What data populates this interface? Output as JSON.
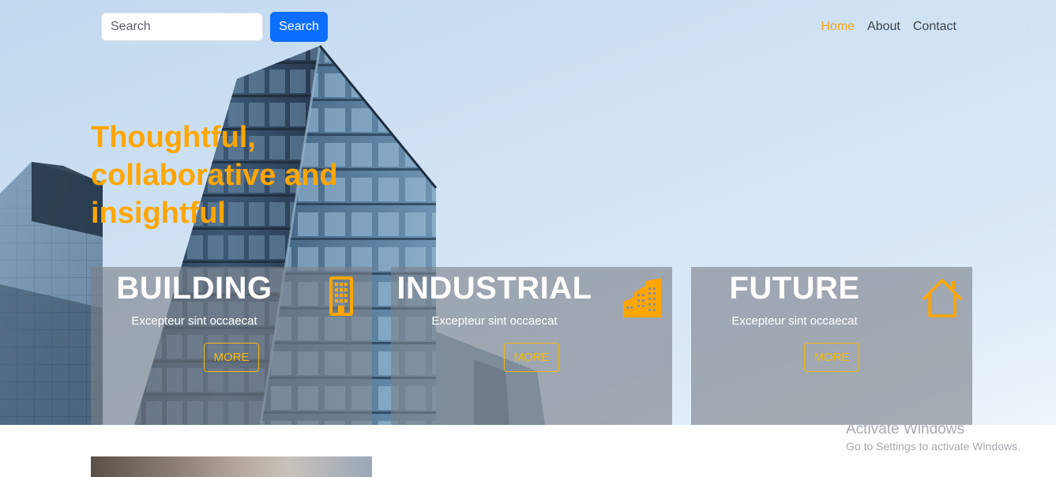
{
  "navbar": {
    "search": {
      "placeholder": "Search",
      "value": ""
    },
    "search_button_label": "Search",
    "links": [
      {
        "label": "Home",
        "active": true
      },
      {
        "label": "About",
        "active": false
      },
      {
        "label": "Contact",
        "active": false
      }
    ]
  },
  "hero": {
    "headline": "Thoughtful, collaborative and insightful"
  },
  "cards": [
    {
      "title": "BUILDING",
      "subtitle": "Excepteur sint occaecat",
      "button_label": "MORE",
      "icon": "building-icon"
    },
    {
      "title": "INDUSTRIAL",
      "subtitle": "Excepteur sint occaecat",
      "button_label": "MORE",
      "icon": "factory-icon"
    },
    {
      "title": "FUTURE",
      "subtitle": "Excepteur sint occaecat",
      "button_label": "MORE",
      "icon": "home-icon"
    }
  ],
  "watermark": {
    "title": "Activate Windows",
    "subtitle": "Go to Settings to activate Windows."
  },
  "colors": {
    "accent": "#ffa600",
    "primary_button": "#0d6efd",
    "card_overlay": "#7a7f88"
  }
}
